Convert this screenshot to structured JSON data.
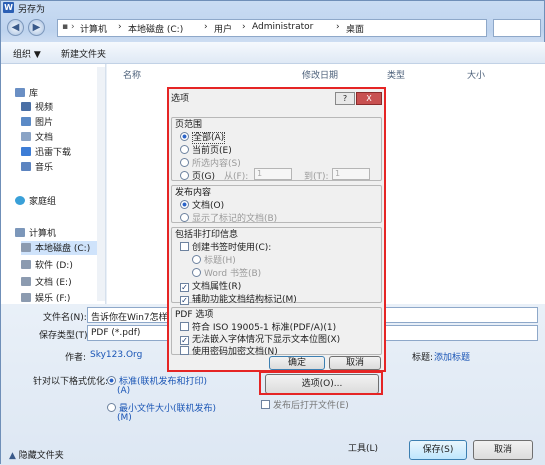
{
  "window": {
    "title": "另存为",
    "app_icon": "W"
  },
  "address": {
    "segments": [
      "计算机",
      "本地磁盘 (C:)",
      "用户",
      "Administrator",
      "桌面"
    ]
  },
  "toolbar": {
    "organize": "组织 ▼",
    "new_folder": "新建文件夹"
  },
  "sidebar": {
    "items": [
      {
        "label": "库",
        "icon": "library-icon",
        "color": "#6a8fc4"
      },
      {
        "label": "视频",
        "icon": "video-icon",
        "color": "#4a6fa5"
      },
      {
        "label": "图片",
        "icon": "picture-icon",
        "color": "#5b8ac6"
      },
      {
        "label": "文档",
        "icon": "document-icon",
        "color": "#8aa3c5"
      },
      {
        "label": "迅雷下载",
        "icon": "thunder-download-icon",
        "color": "#3d7dd6"
      },
      {
        "label": "音乐",
        "icon": "music-icon",
        "color": "#5c84c0"
      },
      {
        "label": "家庭组",
        "icon": "homegroup-icon",
        "color": "#3aa0d8"
      },
      {
        "label": "计算机",
        "icon": "computer-icon",
        "color": "#7c97ba"
      },
      {
        "label": "本地磁盘 (C:)",
        "icon": "drive-icon",
        "color": "#8c9bb0"
      },
      {
        "label": "软件 (D:)",
        "icon": "drive-icon",
        "color": "#8c9bb0"
      },
      {
        "label": "文档 (E:)",
        "icon": "drive-icon",
        "color": "#8c9bb0"
      },
      {
        "label": "娱乐 (F:)",
        "icon": "drive-icon",
        "color": "#8c9bb0"
      }
    ]
  },
  "columns": [
    "名称",
    "修改日期",
    "类型",
    "大小"
  ],
  "form": {
    "filename_label": "文件名(N):",
    "filename_value": "告诉你在Win7怎样",
    "filetype_label": "保存类型(T):",
    "filetype_value": "PDF (*.pdf)",
    "author_label": "作者:",
    "author_value": "Sky123.Org",
    "tag_label": "标题:",
    "tag_value": "添加标题",
    "optimize_label": "针对以下格式优化:",
    "opt1": "标准(联机发布和打印)",
    "opt1b": "(A)",
    "opt2": "最小文件大小(联机发布)",
    "opt2b": "(M)",
    "options_btn": "选项(O)...",
    "open_after": "发布后打开文件(E)",
    "hide_folders": "隐藏文件夹",
    "tools": "工具(L)",
    "save": "保存(S)",
    "cancel": "取消"
  },
  "dialog": {
    "title": "选项",
    "help": "?",
    "close": "X",
    "range_header": "页范围",
    "all": "全部(A)",
    "current": "当前页(E)",
    "selection": "所选内容(S)",
    "pages": "页(G)",
    "from": "从(F):",
    "to": "到(T):",
    "from_val": "1",
    "to_val": "1",
    "publish_header": "发布内容",
    "doc": "文档(O)",
    "doc_markup": "显示了标记的文档(B)",
    "nonprint_header": "包括非打印信息",
    "bookmarks": "创建书签时使用(C):",
    "bm_titles": "标题(H)",
    "bm_word": "Word 书签(B)",
    "props": "文档属性(R)",
    "struct": "辅助功能文档结构标记(M)",
    "pdf_header": "PDF 选项",
    "iso": "符合 ISO 19005-1 标准(PDF/A)(1)",
    "bitmap": "无法嵌入字体情况下显示文本位图(X)",
    "encrypt": "使用密码加密文档(N)",
    "ok": "确定",
    "cancel": "取消"
  }
}
